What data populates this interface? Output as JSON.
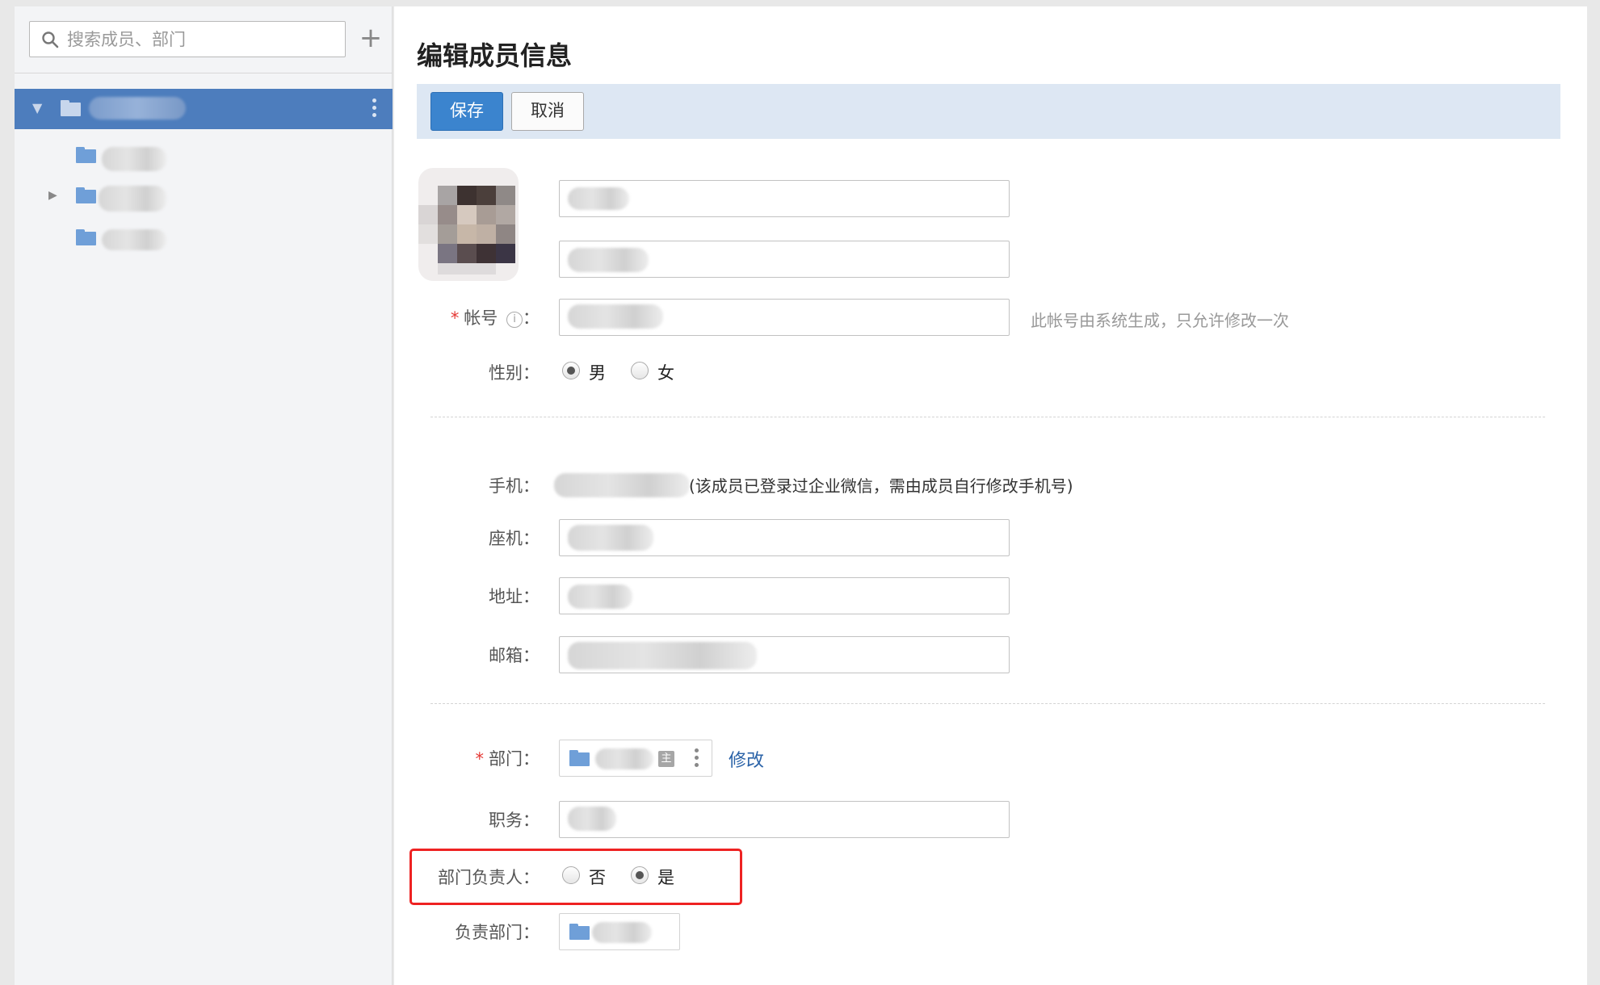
{
  "sidebar": {
    "search_placeholder": "搜索成员、部门",
    "add_symbol": "+",
    "icons": {
      "search": "search-icon",
      "add": "plus-icon",
      "folder": "folder-icon",
      "more": "more-vertical-icon"
    }
  },
  "main": {
    "title": "编辑成员信息",
    "toolbar": {
      "save_label": "保存",
      "cancel_label": "取消"
    },
    "form": {
      "account": {
        "label": "帐号",
        "info_symbol": "i",
        "colon": "：",
        "hint": "此帐号由系统生成，只允许修改一次"
      },
      "gender": {
        "label": "性别：",
        "options": [
          "男",
          "女"
        ],
        "selected": "男"
      },
      "mobile": {
        "label": "手机：",
        "note": "(该成员已登录过企业微信，需由成员自行修改手机号)"
      },
      "landline": {
        "label": "座机："
      },
      "address": {
        "label": "地址："
      },
      "email": {
        "label": "邮箱："
      },
      "department": {
        "label": "部门：",
        "main_badge": "主",
        "edit_link": "修改"
      },
      "position": {
        "label": "职务："
      },
      "dept_head": {
        "label": "部门负责人：",
        "options": [
          "否",
          "是"
        ],
        "selected": "是"
      },
      "managed_dept": {
        "label": "负责部门："
      }
    }
  },
  "colors": {
    "accent": "#3b84ce",
    "sidebar_selected": "#4d7dbd",
    "toolbar_bg": "#dde7f3",
    "highlight": "#ee2222",
    "required": "#e53935",
    "link": "#2b63a8",
    "folder": "#6f9fd8"
  }
}
